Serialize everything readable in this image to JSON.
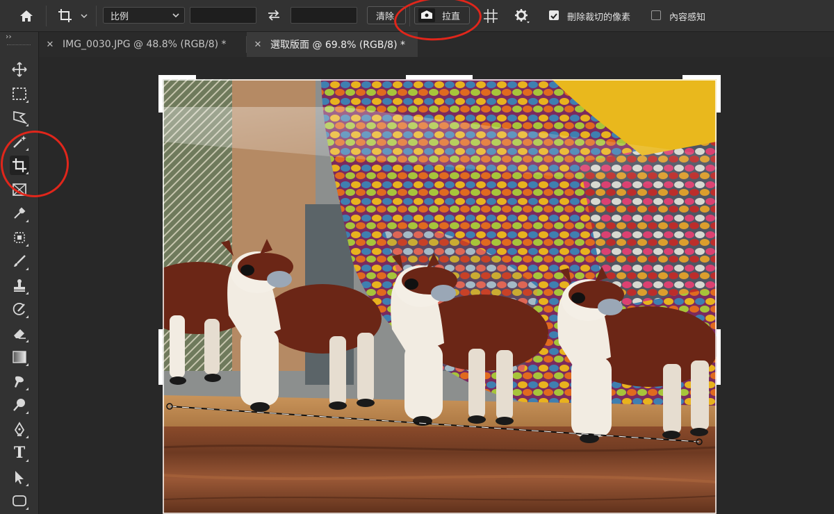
{
  "options_bar": {
    "home_icon": "home-icon",
    "crop_tool_icon": "crop-icon",
    "ratio_select": "比例",
    "width_value": "",
    "height_value": "",
    "swap_icon": "swap-arrows-icon",
    "clear_button": "清除",
    "straighten_button": "拉直",
    "overlay_icon": "grid-overlay-icon",
    "settings_icon": "gear-icon",
    "delete_cropped_pixels": {
      "label": "刪除裁切的像素",
      "checked": true
    },
    "content_aware": {
      "label": "內容感知",
      "checked": false
    }
  },
  "tabs": [
    {
      "title": "IMG_0030.JPG @ 48.8% (RGB/8) *",
      "active": false
    },
    {
      "title": "選取版面 @ 69.8% (RGB/8) *",
      "active": true
    }
  ],
  "toolbar": {
    "collapse_glyph": "››",
    "tools": [
      "move-icon",
      "marquee-icon",
      "lasso-icon",
      "magic-wand-icon",
      "crop-icon",
      "frame-icon",
      "eyedropper-icon",
      "patch-icon",
      "brush-icon",
      "stamp-icon",
      "history-brush-icon",
      "eraser-icon",
      "gradient-icon",
      "smudge-icon",
      "dodge-icon",
      "pen-icon",
      "type-icon",
      "path-select-icon",
      "shape-icon"
    ],
    "active_tool": "crop-icon",
    "type_tool_glyph": "T"
  },
  "annotations": {
    "color": "#e0261b"
  }
}
